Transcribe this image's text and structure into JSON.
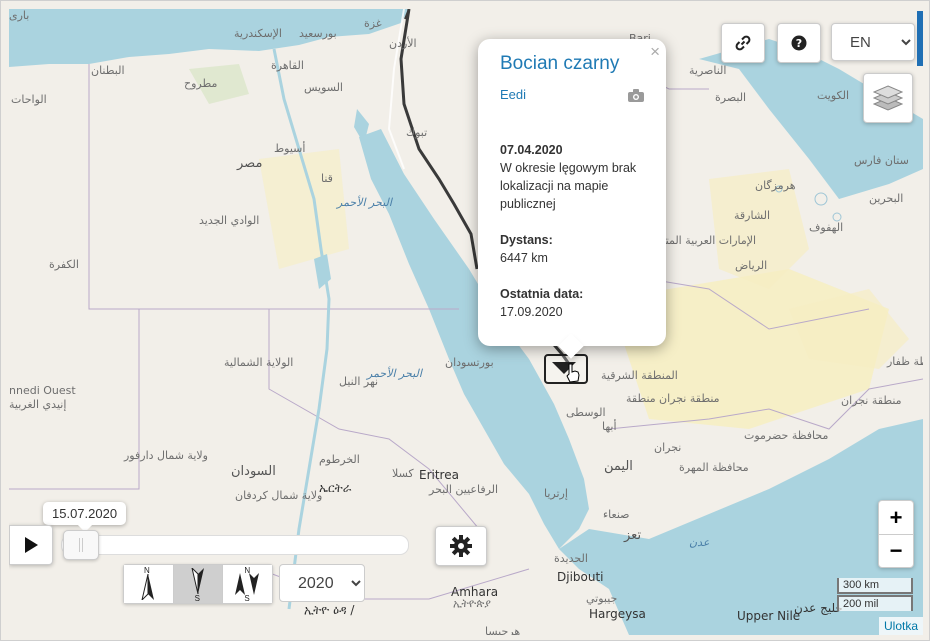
{
  "popup": {
    "title": "Bocian czarny",
    "author": "Eedi",
    "close": "×",
    "date": "07.04.2020",
    "description": "W okresie lęgowym brak lokalizacji na mapie publicznej",
    "distance_label": "Dystans:",
    "distance_value": "6447 km",
    "last_date_label": "Ostatnia data:",
    "last_date_value": "17.09.2020"
  },
  "controls": {
    "language": "EN",
    "language_options": [
      "EN"
    ],
    "year": "2020",
    "year_options": [
      "2020"
    ],
    "zoom_in": "+",
    "zoom_out": "−",
    "compass_labels": [
      {
        "top": "N",
        "bottom": ""
      },
      {
        "top": "",
        "bottom": "S"
      },
      {
        "top": "N",
        "bottom": "S"
      }
    ]
  },
  "timeline": {
    "tooltip": "15.07.2020",
    "progress": 0.0
  },
  "scale": {
    "metric": "300 km",
    "imperial": "200 mil"
  },
  "attribution": "Ulotka",
  "map_labels": [
    "الإسكندرية",
    "بورسعيد",
    "غزة",
    "القاهرة",
    "السويس",
    "الأردن",
    "البطنان",
    "مطروح",
    "الواحات",
    "أسيوط",
    "مصر",
    "تبوك",
    "قنا",
    "البحر الأحمر",
    "الوادي الجديد",
    "الكفرة",
    "الولاية الشمالية",
    "البحر الأحمر",
    "بورتسودان",
    "نهر النيل",
    "nnedi Ouest",
    "إنيدي الغربية",
    "ولاية شمال دارفور",
    "الخرطوم",
    "السودان",
    "كسلا",
    "Eritrea",
    "ኤርትራ",
    "ولاية شمال كردفان",
    "الرفاعيين البحر",
    "إرتريا",
    "الحديدة",
    "Djibouti",
    "جيبوتي",
    "Hargeysa",
    "هرجيسا",
    "ኢትዮጵያ",
    "Amhara",
    "ኢትዮ ዕዳ /",
    "Upper Nile",
    "Bari",
    "الناصرية",
    "البصرة",
    "الكويت",
    "ستان فارس",
    "هرمزگان",
    "البحرين",
    "الشارقة",
    "الهفوف",
    "الإمارات العربية المتحدة",
    "الرياض",
    "المنطقة الشرقية",
    "منطقة",
    "منطقة نجران",
    "منطقة نجران",
    "محافظة ظفار",
    "الوسطى",
    "أبها",
    "نجران",
    "محافظة حضرموت",
    "محافظة المهرة",
    "اليمن",
    "صنعاء",
    "تعز",
    "عدن",
    "خليج عدن",
    "بارى"
  ],
  "colors": {
    "water": "#aad3df",
    "land": "#f2efe9",
    "desert": "#f6eec3",
    "track": "#3a3a3a",
    "accent": "#1f7ab4"
  }
}
